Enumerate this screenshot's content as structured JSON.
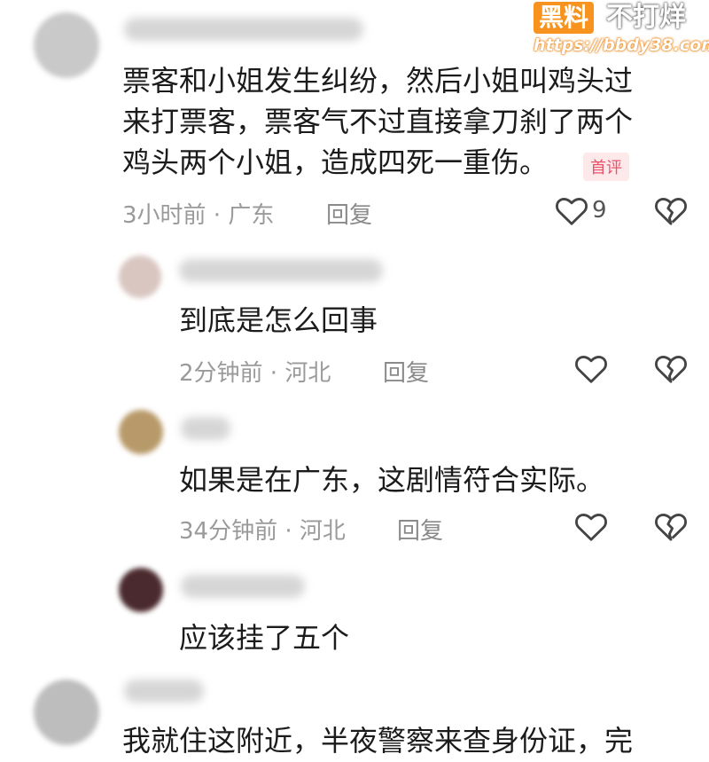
{
  "comments": [
    {
      "lines": [
        "票客和小姐发生纠纷，然后小姐叫鸡头过",
        "来打票客，票客气不过直接拿刀刹了两个",
        "鸡头两个小姐，造成四死一重伤。"
      ],
      "badge": "首评",
      "meta": "3小时前 · 广东",
      "reply": "回复",
      "likes": "9"
    },
    {
      "lines": [
        "到底是怎么回事"
      ],
      "meta": "2分钟前 · 河北",
      "reply": "回复"
    },
    {
      "lines": [
        "如果是在广东，这剧情符合实际。"
      ],
      "meta": "34分钟前 · 河北",
      "reply": "回复"
    },
    {
      "lines": [
        "应该挂了五个"
      ]
    },
    {
      "lines": [
        "我就住这附近，半夜警察来查身份证，完"
      ]
    }
  ],
  "watermark": {
    "brand": "黑料",
    "tagline": "不打烊",
    "url": "https://bbdy38.com"
  },
  "colors": {
    "text": "#1b1b1b",
    "meta": "#9a9a9a",
    "badge_bg": "#fde8ea",
    "badge_text": "#e8546a",
    "watermark": "#f7931e"
  }
}
